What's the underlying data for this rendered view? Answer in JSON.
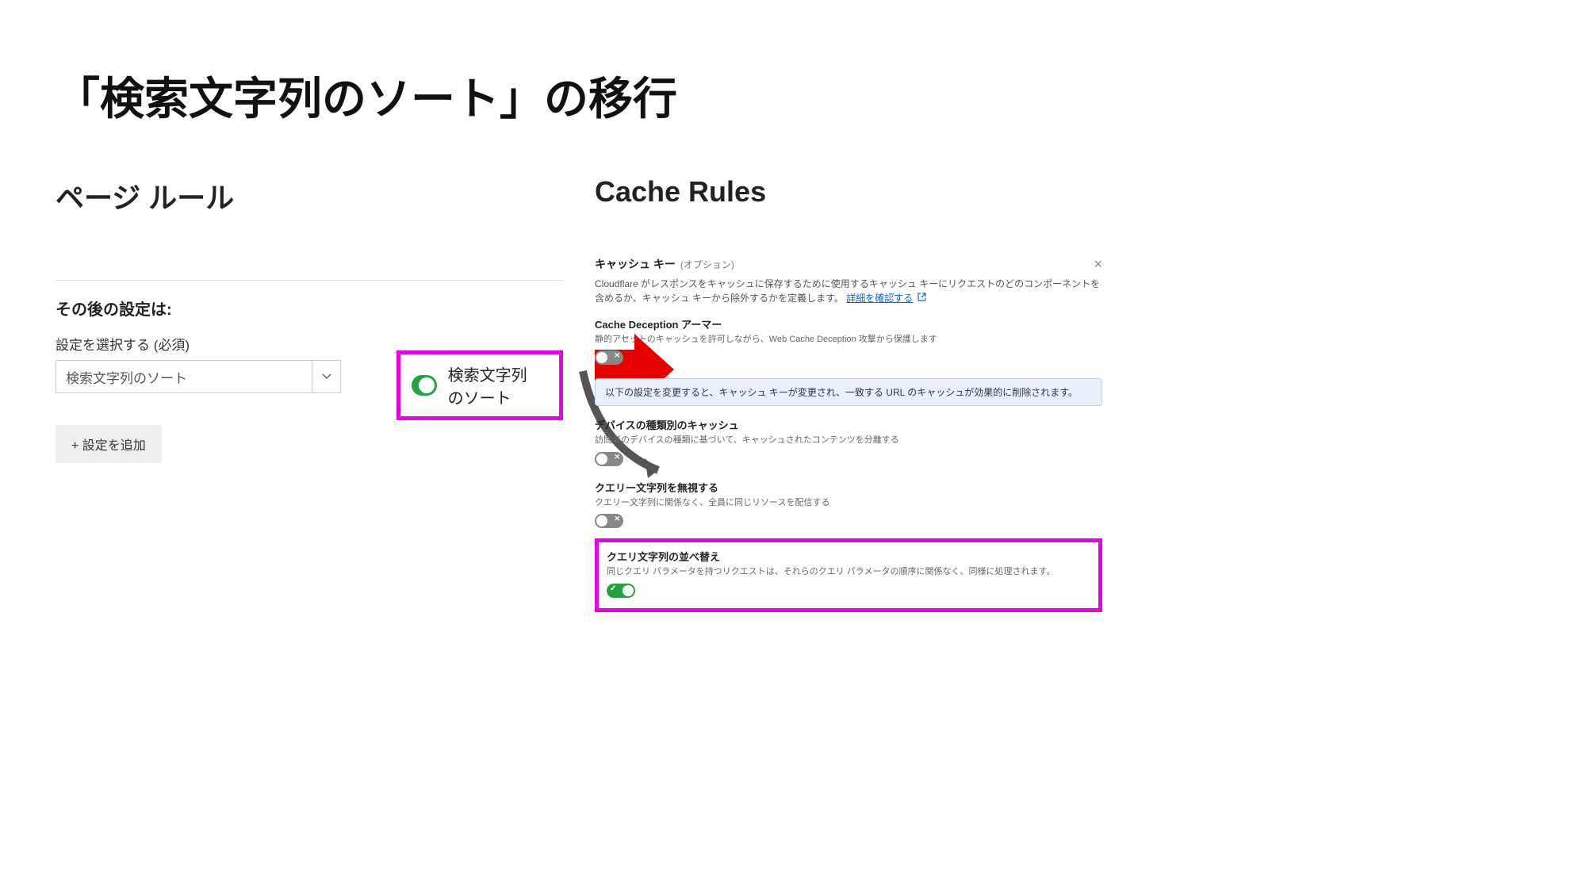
{
  "title": "「検索文字列のソート」の移行",
  "left": {
    "heading": "ページ ルール",
    "subheading": "その後の設定は:",
    "field_label": "設定を選択する (必須)",
    "select_value": "検索文字列のソート",
    "add_button": "+ 設定を追加",
    "toggle_label": "検索文字列のソート"
  },
  "right": {
    "heading": "Cache Rules",
    "cache_key_title": "キャッシュ キー",
    "cache_key_optional": "(オプション)",
    "cache_key_desc": "Cloudflare がレスポンスをキャッシュに保存するために使用するキャッシュ キーにリクエストのどのコンポーネントを含めるか、キャッシュ キーから除外するかを定義します。",
    "cache_key_link": "詳細を確認する",
    "info_banner": "以下の設定を変更すると、キャッシュ キーが変更され、一致する URL のキャッシュが効果的に削除されます。",
    "settings": [
      {
        "title": "Cache Deception アーマー",
        "desc": "静的アセットのキャッシュを許可しながら、Web Cache Deception 攻撃から保護します",
        "on": false
      },
      {
        "title": "デバイスの種類別のキャッシュ",
        "desc": "訪問者のデバイスの種類に基づいて、キャッシュされたコンテンツを分離する",
        "on": false
      },
      {
        "title": "クエリー文字列を無視する",
        "desc": "クエリー文字列に関係なく、全員に同じリソースを配信する",
        "on": false
      },
      {
        "title": "クエリ文字列の並べ替え",
        "desc": "同じクエリ パラメータを持つリクエストは、それらのクエリ パラメータの順序に関係なく、同様に処理されます。",
        "on": true,
        "highlight": true
      }
    ]
  }
}
